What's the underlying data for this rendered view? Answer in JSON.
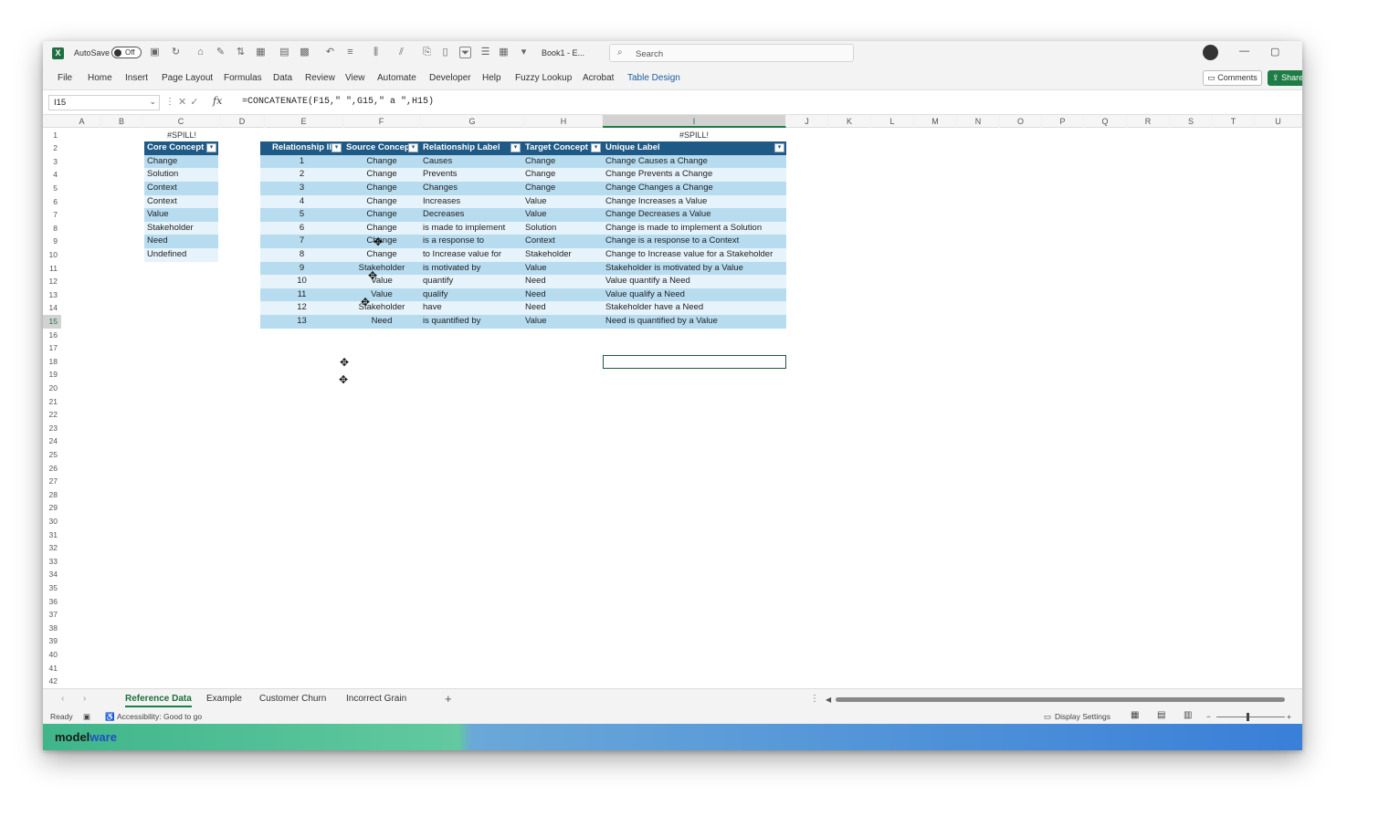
{
  "titlebar": {
    "autosave_label": "AutoSave",
    "autosave_state": "Off",
    "book_title": "Book1 - E...",
    "search_placeholder": "Search"
  },
  "ribbon_tabs": [
    "File",
    "Home",
    "Insert",
    "Page Layout",
    "Formulas",
    "Data",
    "Review",
    "View",
    "Automate",
    "Developer",
    "Help",
    "Fuzzy Lookup",
    "Acrobat",
    "Table Design"
  ],
  "ribbon_buttons": {
    "comments": "Comments",
    "share": "Share"
  },
  "formula_bar": {
    "name_box": "I15",
    "formula": "=CONCATENATE(F15,\" \",G15,\" a \",H15)"
  },
  "columns": [
    "A",
    "B",
    "C",
    "D",
    "E",
    "F",
    "G",
    "H",
    "I",
    "J",
    "K",
    "L",
    "M",
    "N",
    "O",
    "P",
    "Q",
    "R",
    "S",
    "T",
    "U"
  ],
  "selected_column": "I",
  "selected_row": "15",
  "rows": [
    "1",
    "2",
    "3",
    "4",
    "5",
    "6",
    "7",
    "8",
    "9",
    "10",
    "11",
    "12",
    "13",
    "14",
    "15",
    "16",
    "17",
    "18",
    "19",
    "20",
    "21",
    "22",
    "23",
    "24",
    "25",
    "26",
    "27",
    "28",
    "29",
    "30",
    "31",
    "32",
    "33",
    "34",
    "35",
    "36",
    "37",
    "38",
    "39",
    "40",
    "41",
    "42"
  ],
  "spill_c": "#SPILL!",
  "spill_i": "#SPILL!",
  "core_table": {
    "header": "Core Concept",
    "values": [
      "Change",
      "Solution",
      "Context",
      "Context",
      "Value",
      "Stakeholder",
      "Need",
      "Undefined"
    ]
  },
  "rel_table": {
    "headers": [
      "Relationship II",
      "Source Concep",
      "Relationship Label",
      "Target Concept",
      "Unique Label"
    ],
    "rows": [
      [
        "1",
        "Change",
        "Causes",
        "Change",
        "Change Causes a Change"
      ],
      [
        "2",
        "Change",
        "Prevents",
        "Change",
        "Change Prevents a Change"
      ],
      [
        "3",
        "Change",
        "Changes",
        "Change",
        "Change Changes a Change"
      ],
      [
        "4",
        "Change",
        "Increases",
        "Value",
        "Change Increases a Value"
      ],
      [
        "5",
        "Change",
        "Decreases",
        "Value",
        "Change Decreases a Value"
      ],
      [
        "6",
        "Change",
        "is made to implement",
        "Solution",
        "Change is made to implement a Solution"
      ],
      [
        "7",
        "Change",
        "is a response to",
        "Context",
        "Change is a response to a Context"
      ],
      [
        "8",
        "Change",
        "to Increase value for",
        "Stakeholder",
        "Change to Increase value for a Stakeholder"
      ],
      [
        "9",
        "Stakeholder",
        "is motivated by",
        "Value",
        "Stakeholder is motivated by a Value"
      ],
      [
        "10",
        "Value",
        "quantify",
        "Need",
        "Value quantify a Need"
      ],
      [
        "11",
        "Value",
        "qualify",
        "Need",
        "Value qualify a Need"
      ],
      [
        "12",
        "Stakeholder",
        "have",
        "Need",
        "Stakeholder have a Need"
      ],
      [
        "13",
        "Need",
        "is quantified by",
        "Value",
        "Need is quantified by a Value"
      ]
    ]
  },
  "sheet_tabs": [
    "Reference Data",
    "Example",
    "Customer Churn",
    "Incorrect Grain"
  ],
  "active_sheet": "Reference Data",
  "status": {
    "ready": "Ready",
    "accessibility": "Accessibility: Good to go",
    "display_settings": "Display Settings"
  },
  "brand": {
    "name_a": "mod",
    "name_b": "el",
    "name_c": "ware"
  },
  "colors": {
    "table_header": "#1f5a86",
    "band_dark": "#b7dcf0",
    "band_light": "#e6f3fa",
    "excel_green": "#1e7c45"
  }
}
